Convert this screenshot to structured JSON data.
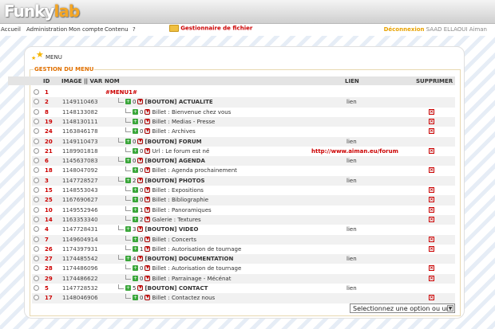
{
  "app": {
    "logo_main": "Funky",
    "logo_accent": "lab"
  },
  "nav": {
    "items": [
      "Accueil",
      "Administration",
      "Mon compte",
      "Contenu",
      "?"
    ],
    "file_manager": "Gestionnaire de fichier",
    "logout": "Déconnexion",
    "user": "SAAD ELLAOUI Aiman"
  },
  "panel": {
    "title": "MENU",
    "legend": "GESTION DU MENU"
  },
  "table": {
    "headers": {
      "id": "ID",
      "image": "IMAGE || VAR",
      "nom": "NOM",
      "lien": "LIEN",
      "supprimer": "SUPPRIMER"
    },
    "rows": [
      {
        "id": "1",
        "image": "",
        "level": 0,
        "order": "",
        "name": "#MENU1#",
        "kind": "root",
        "lien": "",
        "delete": false
      },
      {
        "id": "2",
        "image": "1149110463",
        "level": 1,
        "order": "0",
        "name": "[BOUTON] ACTUALITE",
        "kind": "btn",
        "lien": "lien",
        "delete": false
      },
      {
        "id": "8",
        "image": "1148133082",
        "level": 2,
        "order": "0",
        "name": "Billet : Bienvenue chez vous",
        "kind": "item",
        "lien": "",
        "delete": true
      },
      {
        "id": "19",
        "image": "1148130111",
        "level": 2,
        "order": "0",
        "name": "Billet : Medias - Presse",
        "kind": "item",
        "lien": "",
        "delete": true
      },
      {
        "id": "24",
        "image": "1163846178",
        "level": 2,
        "order": "0",
        "name": "Billet : Archives",
        "kind": "item",
        "lien": "",
        "delete": true
      },
      {
        "id": "20",
        "image": "1149110473",
        "level": 1,
        "order": "0",
        "name": "[BOUTON] FORUM",
        "kind": "btn",
        "lien": "lien",
        "delete": false
      },
      {
        "id": "21",
        "image": "1189901818",
        "level": 2,
        "order": "0",
        "name": "Url : Le forum est né",
        "kind": "item",
        "lien": "http://www.aiman.eu/forum",
        "delete": true
      },
      {
        "id": "6",
        "image": "1145637083",
        "level": 1,
        "order": "0",
        "name": "[BOUTON] AGENDA",
        "kind": "btn",
        "lien": "lien",
        "delete": false
      },
      {
        "id": "18",
        "image": "1148047092",
        "level": 2,
        "order": "0",
        "name": "Billet : Agenda prochainement",
        "kind": "item",
        "lien": "",
        "delete": true
      },
      {
        "id": "3",
        "image": "1147728527",
        "level": 1,
        "order": "2",
        "name": "[BOUTON] PHOTOS",
        "kind": "btn",
        "lien": "lien",
        "delete": false
      },
      {
        "id": "15",
        "image": "1148553043",
        "level": 2,
        "order": "0",
        "name": "Billet : Expositions",
        "kind": "item",
        "lien": "",
        "delete": true
      },
      {
        "id": "25",
        "image": "1167690627",
        "level": 2,
        "order": "0",
        "name": "Billet : Bibliographie",
        "kind": "item",
        "lien": "",
        "delete": true
      },
      {
        "id": "10",
        "image": "1149552946",
        "level": 2,
        "order": "1",
        "name": "Billet : Panoramiques",
        "kind": "item",
        "lien": "",
        "delete": true
      },
      {
        "id": "14",
        "image": "1163353340",
        "level": 2,
        "order": "2",
        "name": "Galerie : Textures",
        "kind": "item",
        "lien": "",
        "delete": true
      },
      {
        "id": "4",
        "image": "1147728431",
        "level": 1,
        "order": "3",
        "name": "[BOUTON] VIDEO",
        "kind": "btn",
        "lien": "lien",
        "delete": false
      },
      {
        "id": "7",
        "image": "1149604914",
        "level": 2,
        "order": "0",
        "name": "Billet : Concerts",
        "kind": "item",
        "lien": "",
        "delete": true
      },
      {
        "id": "26",
        "image": "1174397931",
        "level": 2,
        "order": "1",
        "name": "Billet : Autorisation de tournage",
        "kind": "item",
        "lien": "",
        "delete": true
      },
      {
        "id": "27",
        "image": "1174485542",
        "level": 1,
        "order": "4",
        "name": "[BOUTON] DOCUMENTATION",
        "kind": "btn",
        "lien": "lien",
        "delete": false
      },
      {
        "id": "28",
        "image": "1174486096",
        "level": 2,
        "order": "0",
        "name": "Billet : Autorisation de tournage",
        "kind": "item",
        "lien": "",
        "delete": true
      },
      {
        "id": "29",
        "image": "1174486622",
        "level": 2,
        "order": "0",
        "name": "Billet : Parrainage - Mécénat",
        "kind": "item",
        "lien": "",
        "delete": true
      },
      {
        "id": "5",
        "image": "1147728532",
        "level": 1,
        "order": "5",
        "name": "[BOUTON] CONTACT",
        "kind": "btn",
        "lien": "lien",
        "delete": false
      },
      {
        "id": "17",
        "image": "1148046906",
        "level": 2,
        "order": "0",
        "name": "Billet : Contactez nous",
        "kind": "item",
        "lien": "",
        "delete": true
      }
    ]
  },
  "select": {
    "value": "Selectionnez une option ou un"
  }
}
